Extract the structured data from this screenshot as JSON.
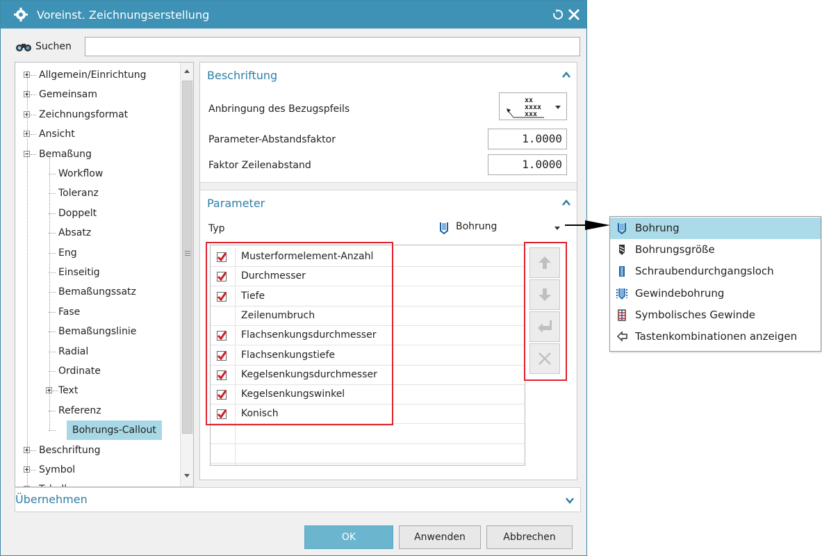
{
  "dialog": {
    "title": "Voreinst. Zeichnungserstellung",
    "search_label": "Suchen",
    "search_value": ""
  },
  "tree": {
    "items": [
      {
        "label": "Allgemein/Einrichtung",
        "level": 0,
        "expander": "plus"
      },
      {
        "label": "Gemeinsam",
        "level": 0,
        "expander": "plus"
      },
      {
        "label": "Zeichnungsformat",
        "level": 0,
        "expander": "plus"
      },
      {
        "label": "Ansicht",
        "level": 0,
        "expander": "plus"
      },
      {
        "label": "Bemaßung",
        "level": 0,
        "expander": "minus"
      },
      {
        "label": "Workflow",
        "level": 1
      },
      {
        "label": "Toleranz",
        "level": 1
      },
      {
        "label": "Doppelt",
        "level": 1
      },
      {
        "label": "Absatz",
        "level": 1
      },
      {
        "label": "Eng",
        "level": 1
      },
      {
        "label": "Einseitig",
        "level": 1
      },
      {
        "label": "Bemaßungssatz",
        "level": 1
      },
      {
        "label": "Fase",
        "level": 1
      },
      {
        "label": "Bemaßungslinie",
        "level": 1
      },
      {
        "label": "Radial",
        "level": 1
      },
      {
        "label": "Ordinate",
        "level": 1
      },
      {
        "label": "Text",
        "level": 1,
        "expander": "plus"
      },
      {
        "label": "Referenz",
        "level": 1
      },
      {
        "label": "Bohrungs-Callout",
        "level": 1,
        "selected": true
      },
      {
        "label": "Beschriftung",
        "level": 0,
        "expander": "plus"
      },
      {
        "label": "Symbol",
        "level": 0,
        "expander": "plus"
      },
      {
        "label": "Tabelle",
        "level": 0,
        "expander": "plus"
      }
    ]
  },
  "beschriftung": {
    "heading": "Beschriftung",
    "anbringung_label": "Anbringung des Bezugspfeils",
    "leader_glyph": {
      "line1": "xx",
      "line2": "xxxx",
      "line3": "xxx"
    },
    "abstandsfaktor_label": "Parameter-Abstandsfaktor",
    "abstandsfaktor_value": "1.0000",
    "zeilenabstand_label": "Faktor Zeilenabstand",
    "zeilenabstand_value": "1.0000"
  },
  "parameter": {
    "heading": "Parameter",
    "typ_label": "Typ",
    "typ_value": "Bohrung",
    "rows": [
      {
        "label": "Musterformelement-Anzahl",
        "checked": true
      },
      {
        "label": "Durchmesser",
        "checked": true
      },
      {
        "label": "Tiefe",
        "checked": true
      },
      {
        "label": "Zeilenumbruch",
        "checked": false
      },
      {
        "label": "Flachsenkungsdurchmesser",
        "checked": true
      },
      {
        "label": "Flachsenkungstiefe",
        "checked": true
      },
      {
        "label": "Kegelsenkungsdurchmesser",
        "checked": true
      },
      {
        "label": "Kegelsenkungswinkel",
        "checked": true
      },
      {
        "label": "Konisch",
        "checked": true
      },
      {
        "label": "",
        "checked": false
      },
      {
        "label": "",
        "checked": false
      },
      {
        "label": "",
        "checked": false
      }
    ]
  },
  "ubernehmen": {
    "heading": "Übernehmen"
  },
  "buttons": {
    "ok": "OK",
    "apply": "Anwenden",
    "cancel": "Abbrechen"
  },
  "popup": {
    "items": [
      {
        "label": "Bohrung",
        "icon": "hole-icon",
        "selected": true
      },
      {
        "label": "Bohrungsgröße",
        "icon": "drill-size-icon"
      },
      {
        "label": "Schraubendurchgangsloch",
        "icon": "screw-clearance-hole-icon"
      },
      {
        "label": "Gewindebohrung",
        "icon": "threaded-hole-icon"
      },
      {
        "label": "Symbolisches Gewinde",
        "icon": "symbolic-thread-icon"
      },
      {
        "label": "Tastenkombinationen anzeigen",
        "icon": "arrow-left-icon"
      }
    ]
  },
  "colors": {
    "titlebar": "#3d92b5",
    "accent": "#2d7fa6",
    "selection": "#a8d8e6",
    "highlight_box": "#e0202c",
    "check": "#d01f2a"
  }
}
